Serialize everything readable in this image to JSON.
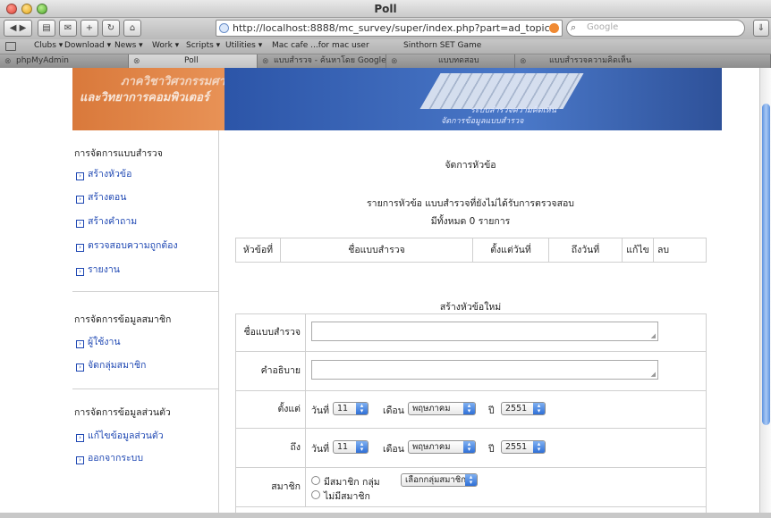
{
  "window": {
    "title": "Poll"
  },
  "toolbar": {
    "url": "http://localhost:8888/mc_survey/super/index.php?part=ad_topic",
    "search_placeholder": "Google"
  },
  "bookmarks": [
    "Clubs ▾",
    "Download ▾",
    "News ▾",
    "Work ▾",
    "Scripts ▾",
    "Utilities ▾",
    "Mac cafe ...for mac user",
    "Sinthorn SET Game"
  ],
  "tabs": [
    "phpMyAdmin",
    "Poll",
    "แบบสำรวจ - ค้นหาโดย Google",
    "แบบทดสอบ",
    "แบบสำรวจความคิดเห็น"
  ],
  "banner": {
    "line1": "ภาควิชาวิศวกรรมศาสตร์",
    "line2": "และวิทยาการคอมพิวเตอร์",
    "sub1": "ระบบสำรวจความคิดเห็น",
    "sub2": "จัดการข้อมูลแบบสำรวจ"
  },
  "sidebar": {
    "sections": [
      {
        "heading": "การจัดการแบบสำรวจ",
        "links": [
          "สร้างหัวข้อ",
          "สร้างตอน",
          "สร้างคำถาม",
          "ตรวจสอบความถูกต้อง",
          "รายงาน"
        ]
      },
      {
        "heading": "การจัดการข้อมูลสมาชิก",
        "links": [
          "ผู้ใช้งาน",
          "จัดกลุ่มสมาชิก"
        ]
      },
      {
        "heading": "การจัดการข้อมูลส่วนตัว",
        "links": [
          "แก้ไขข้อมูลส่วนตัว",
          "ออกจากระบบ"
        ]
      }
    ]
  },
  "main": {
    "title": "จัดการหัวข้อ",
    "list_caption": "รายการหัวข้อ แบบสำรวจที่ยังไม่ได้รับการตรวจสอบ",
    "total": "มีทั้งหมด 0 รายการ",
    "columns": [
      "หัวข้อที่",
      "ชื่อแบบสำรวจ",
      "ตั้งแต่วันที่",
      "ถึงวันที่",
      "แก้ไข",
      "ลบ"
    ],
    "form_title": "สร้างหัวข้อใหม่",
    "form": {
      "name_label": "ชื่อแบบสำรวจ",
      "desc_label": "คำอธิบาย",
      "from_label": "ตั้งแต่",
      "to_label": "ถึง",
      "day_label": "วันที่",
      "month_label": "เดือน",
      "year_label": "ปี",
      "from": {
        "day": "11",
        "month": "พฤษภาคม",
        "year": "2551"
      },
      "to": {
        "day": "11",
        "month": "พฤษภาคม",
        "year": "2551"
      },
      "member_label": "สมาชิก",
      "member_opt1": "มีสมาชิก กลุ่ม",
      "member_group_select": "เลือกกลุ่มสมาชิก",
      "member_opt2": "ไม่มีสมาชิก"
    }
  }
}
